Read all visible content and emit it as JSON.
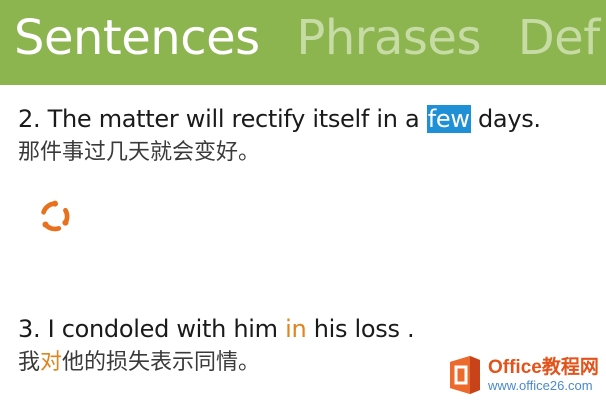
{
  "tabs": [
    {
      "label": "Sentences",
      "active": true
    },
    {
      "label": "Phrases",
      "active": false
    },
    {
      "label": "Def",
      "active": false
    }
  ],
  "sentences": [
    {
      "en_before": "2. The matter will rectify itself in a ",
      "en_highlight": "few",
      "en_after": " days.",
      "zh_before": "那件事过几天就会变好。",
      "zh_highlight": "",
      "zh_after": ""
    },
    {
      "en_before": "3. I condoled with him ",
      "en_highlight": "in",
      "en_after": " his loss .",
      "zh_before": "我",
      "zh_highlight": "对",
      "zh_after": "他的损失表示同情。"
    }
  ],
  "spinner": {
    "icon": "loading-spinner-icon",
    "color": "#e8711f"
  },
  "watermark": {
    "icon": "office-logo-icon",
    "title": "Office教程网",
    "url": "www.office26.com"
  },
  "colors": {
    "header": "#8cb54f",
    "active_tab": "#ffffff",
    "inactive_tab": "#c7dca5",
    "selection": "#1f8fd6",
    "match_highlight": "#e0841e"
  }
}
